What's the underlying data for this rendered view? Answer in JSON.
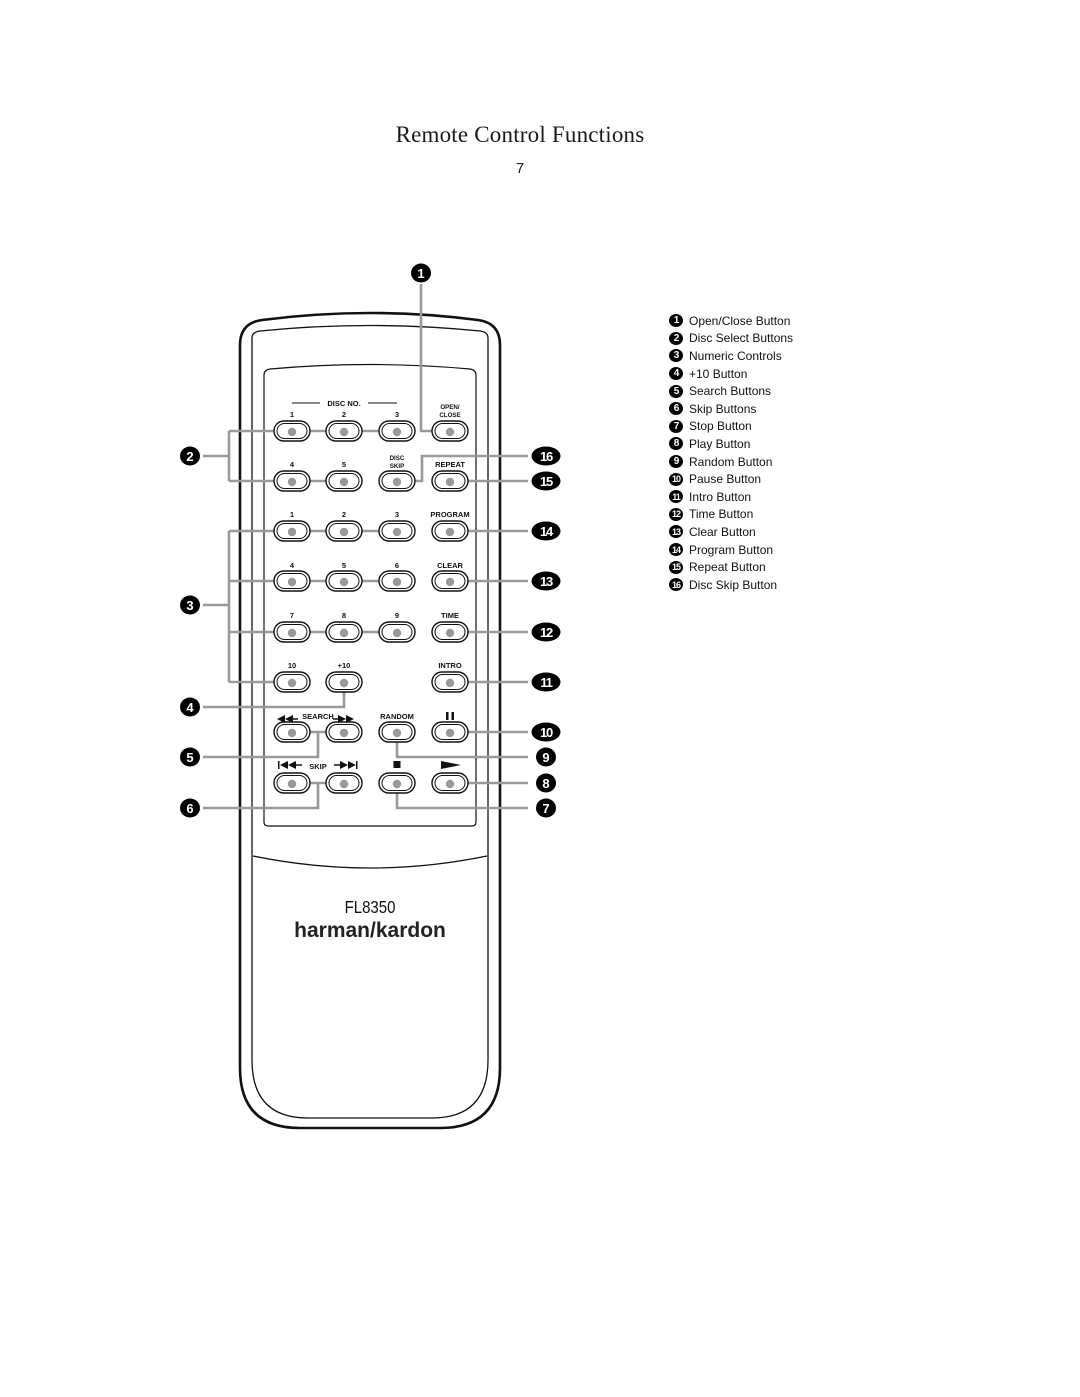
{
  "page": {
    "title": "Remote Control Functions",
    "page_number": "7"
  },
  "remote": {
    "model": "FL8350",
    "brand": "harman/kardon",
    "header_labels": {
      "disc_no": "DISC NO.",
      "open_close": [
        "OPEN/",
        "CLOSE"
      ],
      "disc_skip": [
        "DISC",
        "SKIP"
      ]
    },
    "rows": [
      [
        "1",
        "2",
        "3",
        "OPEN_CLOSE"
      ],
      [
        "4",
        "5",
        "DISC_SKIP",
        "REPEAT"
      ],
      [
        "1",
        "2",
        "3",
        "PROGRAM"
      ],
      [
        "4",
        "5",
        "6",
        "CLEAR"
      ],
      [
        "7",
        "8",
        "9",
        "TIME"
      ],
      [
        "10",
        "+10",
        "",
        "INTRO"
      ],
      [
        "SEARCH",
        "",
        "RANDOM",
        "PAUSE"
      ],
      [
        "SKIP",
        "",
        "STOP",
        "PLAY"
      ]
    ],
    "labels": {
      "repeat": "REPEAT",
      "program": "PROGRAM",
      "clear": "CLEAR",
      "time": "TIME",
      "intro": "INTRO",
      "search": "SEARCH",
      "random": "RANDOM",
      "skip": "SKIP",
      "ten": "10",
      "plus_ten": "+10",
      "disc_digits": [
        "1",
        "2",
        "3",
        "4",
        "5"
      ],
      "num_digits": [
        "1",
        "2",
        "3",
        "4",
        "5",
        "6",
        "7",
        "8",
        "9"
      ]
    },
    "icons": {
      "search_back": "rewind-icon",
      "search_fwd": "fast-forward-icon",
      "skip_back": "skip-back-icon",
      "skip_fwd": "skip-forward-icon",
      "pause": "pause-icon",
      "stop": "stop-icon",
      "play": "play-icon"
    }
  },
  "callouts": [
    "1",
    "2",
    "3",
    "4",
    "5",
    "6",
    "7",
    "8",
    "9",
    "10",
    "11",
    "12",
    "13",
    "14",
    "15",
    "16"
  ],
  "legend": [
    {
      "num": "1",
      "label": "Open/Close Button"
    },
    {
      "num": "2",
      "label": "Disc Select Buttons"
    },
    {
      "num": "3",
      "label": "Numeric Controls"
    },
    {
      "num": "4",
      "label": "+10 Button"
    },
    {
      "num": "5",
      "label": "Search Buttons"
    },
    {
      "num": "6",
      "label": "Skip Buttons"
    },
    {
      "num": "7",
      "label": "Stop Button"
    },
    {
      "num": "8",
      "label": "Play Button"
    },
    {
      "num": "9",
      "label": "Random Button"
    },
    {
      "num": "10",
      "label": "Pause Button"
    },
    {
      "num": "11",
      "label": "Intro Button"
    },
    {
      "num": "12",
      "label": "Time Button"
    },
    {
      "num": "13",
      "label": "Clear Button"
    },
    {
      "num": "14",
      "label": "Program Button"
    },
    {
      "num": "15",
      "label": "Repeat Button"
    },
    {
      "num": "16",
      "label": "Disc Skip Button"
    }
  ],
  "colors": {
    "outline": "#111111",
    "leader": "#9a9a9a",
    "button_dot": "#999999"
  }
}
